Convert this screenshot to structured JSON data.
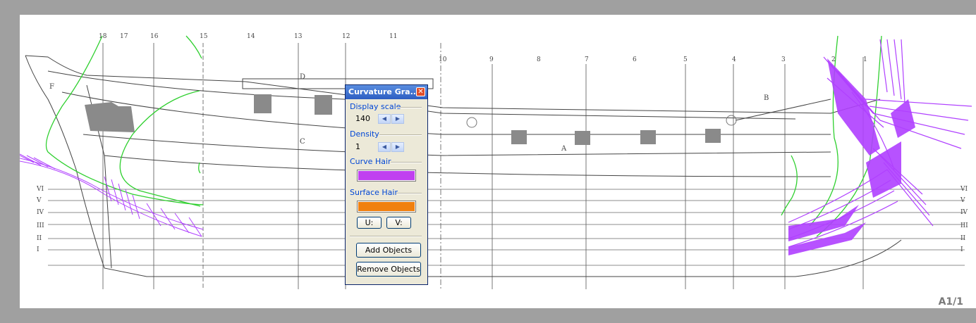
{
  "panel": {
    "title": "Curvature Gra...",
    "close_icon": "close-icon",
    "display_scale": {
      "label": "Display scale",
      "value": "140"
    },
    "density": {
      "label": "Density",
      "value": "1"
    },
    "curve_hair": {
      "label": "Curve Hair",
      "color": "#c040f0"
    },
    "surface_hair": {
      "label": "Surface Hair",
      "color": "#f08010"
    },
    "u_label": "U:",
    "v_label": "V:",
    "add_objects_label": "Add Objects",
    "remove_objects_label": "Remove Objects"
  },
  "page_indicator": "A1/1",
  "drawing": {
    "station_labels": [
      "18",
      "17",
      "16",
      "15",
      "14",
      "13",
      "12",
      "11",
      "10",
      "9",
      "8",
      "7",
      "6",
      "5",
      "4",
      "3",
      "2",
      "1"
    ],
    "waterline_labels": [
      "VI",
      "V",
      "IV",
      "III",
      "II",
      "I"
    ],
    "part_labels": [
      "D",
      "F",
      "C",
      "A",
      "B"
    ],
    "colors": {
      "curve": "#30d030",
      "hair": "#b040ff",
      "hull_block": "#808080"
    }
  }
}
